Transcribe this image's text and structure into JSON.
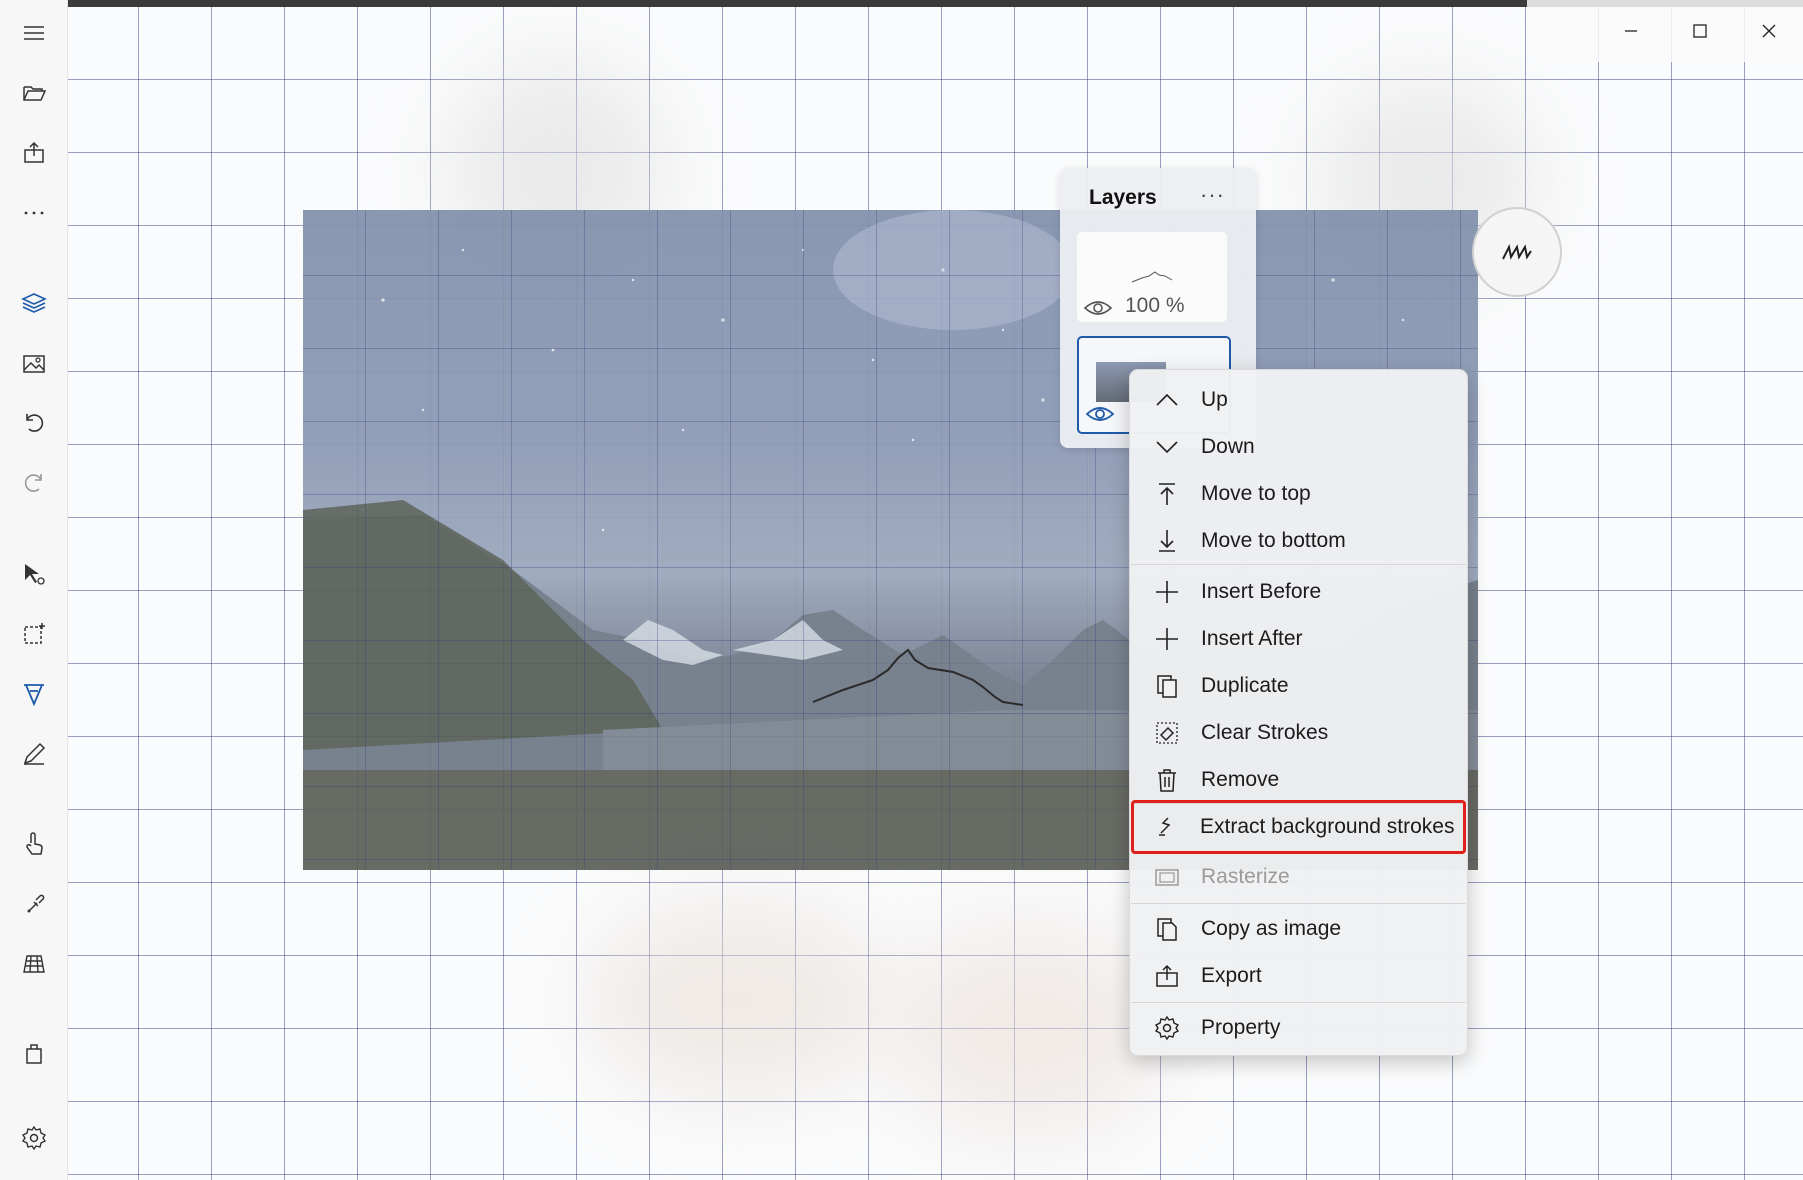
{
  "colors": {
    "accent": "#1e5aa8",
    "highlight_box": "#e0201b",
    "grid_line": "#5a5aa0"
  },
  "toolbar": {
    "items": [
      {
        "icon": "hamburger-menu-icon"
      },
      {
        "icon": "open-folder-icon"
      },
      {
        "icon": "export-icon"
      },
      {
        "icon": "more-icon"
      },
      {
        "icon": "layers-icon"
      },
      {
        "icon": "image-icon"
      },
      {
        "icon": "undo-icon"
      },
      {
        "icon": "redo-icon"
      },
      {
        "icon": "select-pointer-icon"
      },
      {
        "icon": "lasso-select-icon"
      },
      {
        "icon": "pen-icon"
      },
      {
        "icon": "pencil-icon"
      },
      {
        "icon": "touch-icon"
      },
      {
        "icon": "eyedropper-icon"
      },
      {
        "icon": "grid-icon"
      },
      {
        "icon": "shopping-bag-icon"
      },
      {
        "icon": "settings-gear-icon"
      }
    ]
  },
  "window": {
    "controls": [
      "minimize",
      "maximize",
      "close"
    ]
  },
  "layers": {
    "title": "Layers",
    "more_label": "···",
    "layer1_opacity": "100 %"
  },
  "context_menu": {
    "items": [
      {
        "label": "Up",
        "icon": "chevron-up-icon"
      },
      {
        "label": "Down",
        "icon": "chevron-down-icon"
      },
      {
        "label": "Move to top",
        "icon": "move-to-top-icon"
      },
      {
        "label": "Move to bottom",
        "icon": "move-to-bottom-icon"
      },
      {
        "label": "Insert Before",
        "icon": "plus-icon"
      },
      {
        "label": "Insert After",
        "icon": "plus-icon"
      },
      {
        "label": "Duplicate",
        "icon": "duplicate-icon"
      },
      {
        "label": "Clear Strokes",
        "icon": "eraser-icon"
      },
      {
        "label": "Remove",
        "icon": "trash-icon"
      },
      {
        "label": "Extract background strokes",
        "icon": "extract-strokes-icon",
        "highlighted": true
      },
      {
        "label": "Rasterize",
        "icon": "rasterize-icon",
        "disabled": true
      },
      {
        "label": "Copy as image",
        "icon": "copy-image-icon"
      },
      {
        "label": "Export",
        "icon": "export-icon"
      },
      {
        "label": "Property",
        "icon": "gear-icon"
      }
    ]
  }
}
